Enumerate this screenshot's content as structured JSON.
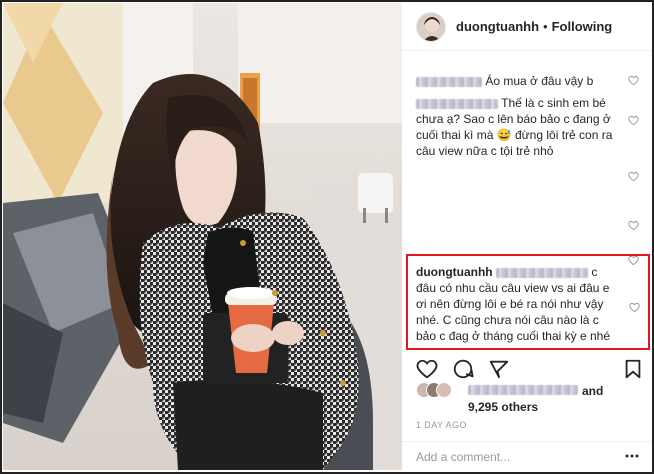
{
  "post": {
    "username": "duongtuanhh",
    "separator": "•",
    "follow_status": "Following"
  },
  "comments": [
    {
      "text": "Áo mua ở đâu vậy b"
    },
    {
      "text": "Thế là c sinh em bé chưa ạ? Sao c lên báo bảo c đang ở cuối thai kì mà 😅 đừng lôi trẻ con ra câu view nữa c tội trẻ nhỏ"
    },
    {
      "text": ""
    },
    {
      "text": ""
    }
  ],
  "highlighted_reply": {
    "username": "duongtuanhh",
    "text": "c đâu có nhu cầu câu view vs ai đâu e ơi nên đừng lôi e bé ra nói như vậy nhé. C cũng chưa nói câu nào là c bảo c đag ở tháng cuối thai kỳ e nhé"
  },
  "likes": {
    "and_label": "and",
    "others_label": "9,295 others"
  },
  "time_ago": "1 DAY AGO",
  "add_comment": {
    "placeholder": "Add a comment..."
  },
  "colors": {
    "highlight": "#e0161b",
    "text": "#262626",
    "muted": "#999999"
  },
  "icons": [
    "heart-icon",
    "comment-icon",
    "share-icon",
    "bookmark-icon",
    "more-options-icon"
  ]
}
